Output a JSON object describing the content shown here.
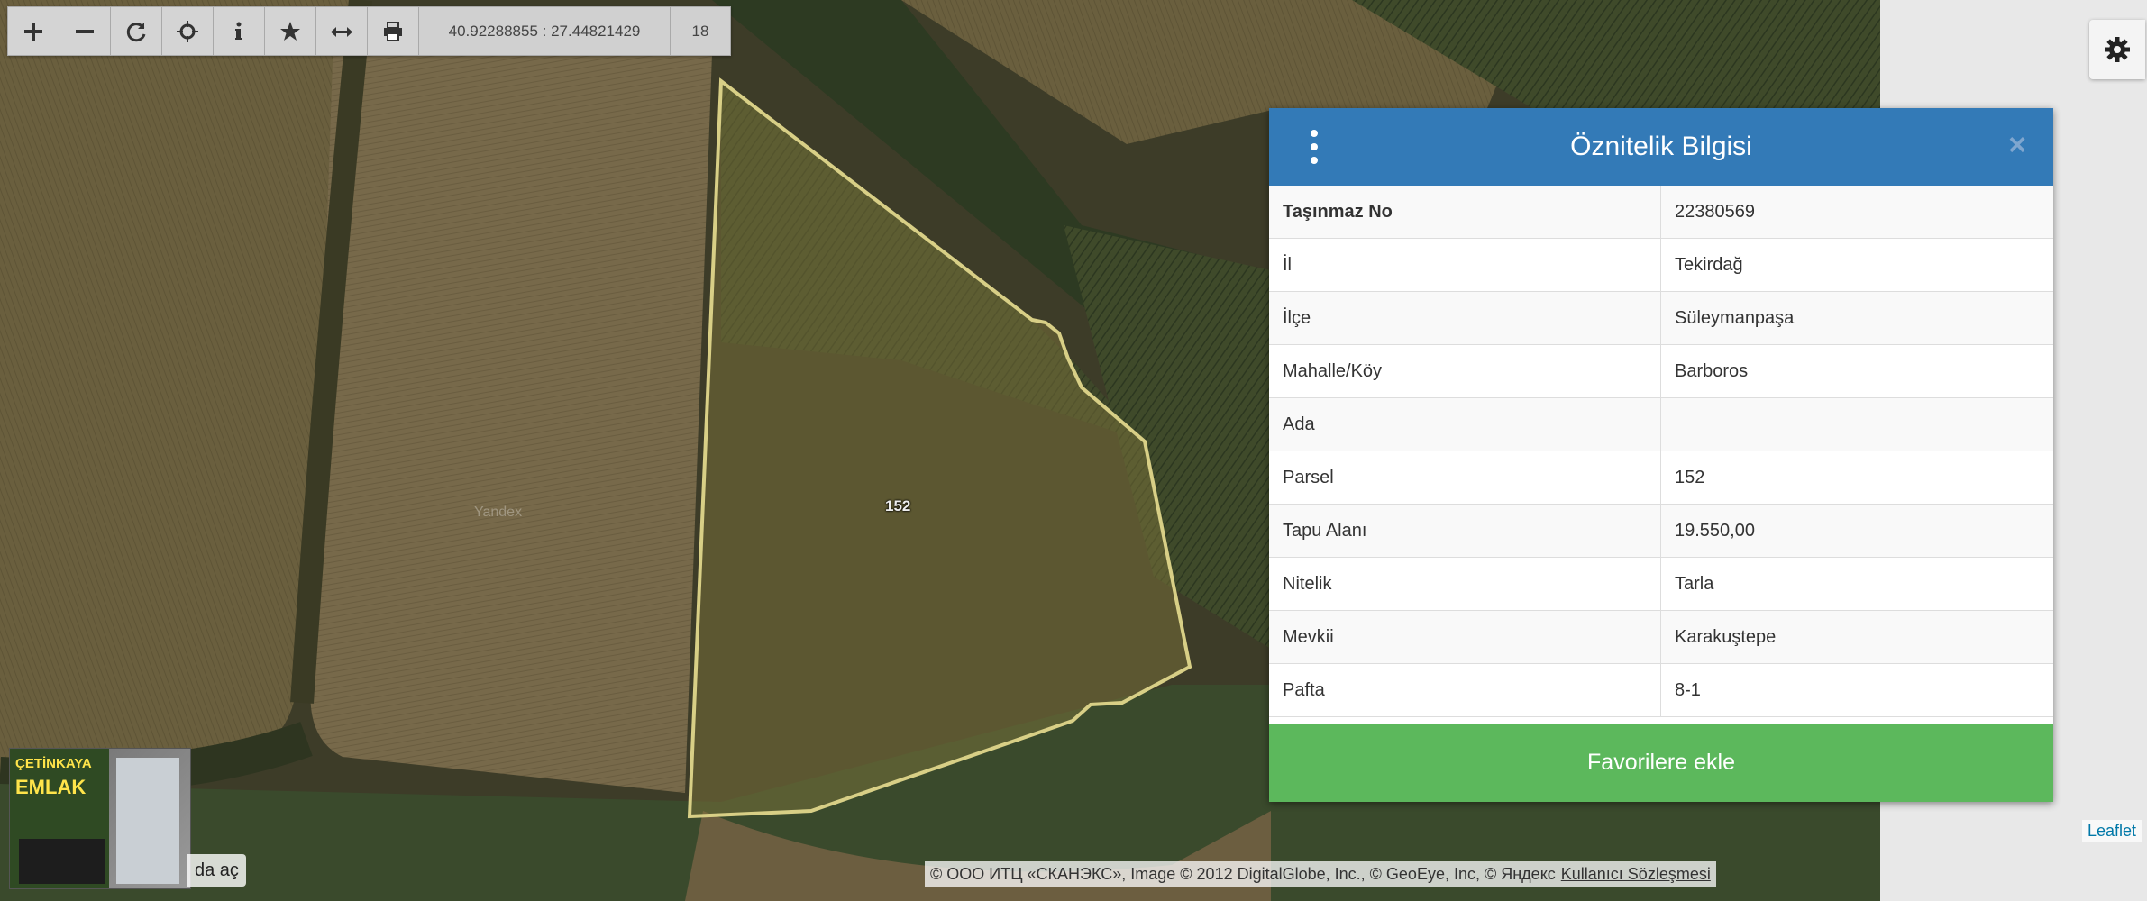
{
  "toolbar": {
    "buttons": [
      {
        "name": "zoom-in",
        "glyph": "+"
      },
      {
        "name": "zoom-out",
        "glyph": "−"
      },
      {
        "name": "refresh",
        "glyph": "refresh"
      },
      {
        "name": "locate",
        "glyph": "crosshair"
      },
      {
        "name": "info",
        "glyph": "i"
      },
      {
        "name": "favorites",
        "glyph": "★"
      },
      {
        "name": "measure",
        "glyph": "↔"
      },
      {
        "name": "print",
        "glyph": "printer"
      }
    ],
    "coords": "40.92288855 : 27.44821429",
    "zoom": "18"
  },
  "map": {
    "parcel_label": "152",
    "provider_watermark": "Yandex"
  },
  "popup": {
    "title": "Öznitelik Bilgisi",
    "close_glyph": "×",
    "rows": [
      {
        "key": "Taşınmaz No",
        "value": "22380569"
      },
      {
        "key": "İl",
        "value": "Tekirdağ"
      },
      {
        "key": "İlçe",
        "value": "Süleymanpaşa"
      },
      {
        "key": "Mahalle/Köy",
        "value": "Barboros"
      },
      {
        "key": "Ada",
        "value": ""
      },
      {
        "key": "Parsel",
        "value": "152"
      },
      {
        "key": "Tapu Alanı",
        "value": "19.550,00"
      },
      {
        "key": "Nitelik",
        "value": "Tarla"
      },
      {
        "key": "Mevkii",
        "value": "Karakuştepe"
      },
      {
        "key": "Pafta",
        "value": "8-1"
      }
    ],
    "favorite_button": "Favorilere ekle"
  },
  "attribution": {
    "text": "© ООО ИТЦ «СКАНЭКС», Image © 2012 DigitalGlobe, Inc., © GeoEye, Inc, © Яндекс",
    "link": "Kullanıcı Sözleşmesi"
  },
  "leaflet": "Leaflet",
  "ad": {
    "line1": "ÇETİNKAYA",
    "line2": "EMLAK",
    "open_text": "da aç"
  },
  "colors": {
    "popup_header": "#337ab7",
    "favorite_button": "#5cb85c",
    "parcel_outline": "#d8cf86"
  }
}
